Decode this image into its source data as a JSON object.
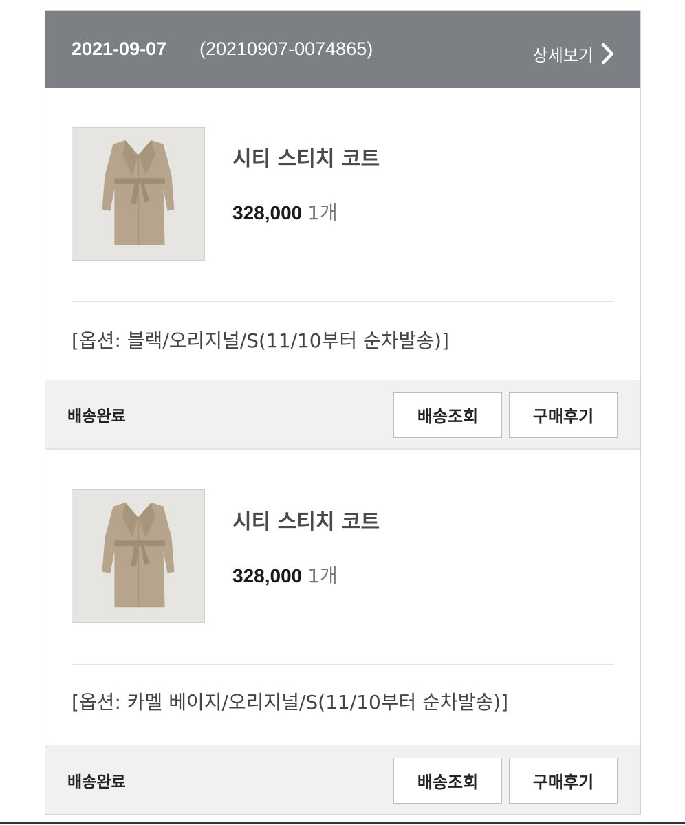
{
  "order": {
    "date": "2021-09-07",
    "number": "(20210907-0074865)",
    "detail_label": "상세보기",
    "detail_icon": "chevron-right-icon"
  },
  "items": [
    {
      "name": "시티 스티치 코트",
      "price": "328,000",
      "qty": "1개",
      "option": "[옵션: 블랙/오리지널/S(11/10부터 순차발송)]",
      "status": "배송완료",
      "track_label": "배송조회",
      "review_label": "구매후기",
      "image": "beige-coat-image"
    },
    {
      "name": "시티 스티치 코트",
      "price": "328,000",
      "qty": "1개",
      "option": "[옵션: 카멜 베이지/오리지널/S(11/10부터 순차발송)]",
      "status": "배송완료",
      "track_label": "배송조회",
      "review_label": "구매후기",
      "image": "beige-coat-image"
    }
  ],
  "colors": {
    "header_bg": "#7c7f84",
    "status_bg": "#f1f1f1",
    "coat": "#b6a58c"
  }
}
